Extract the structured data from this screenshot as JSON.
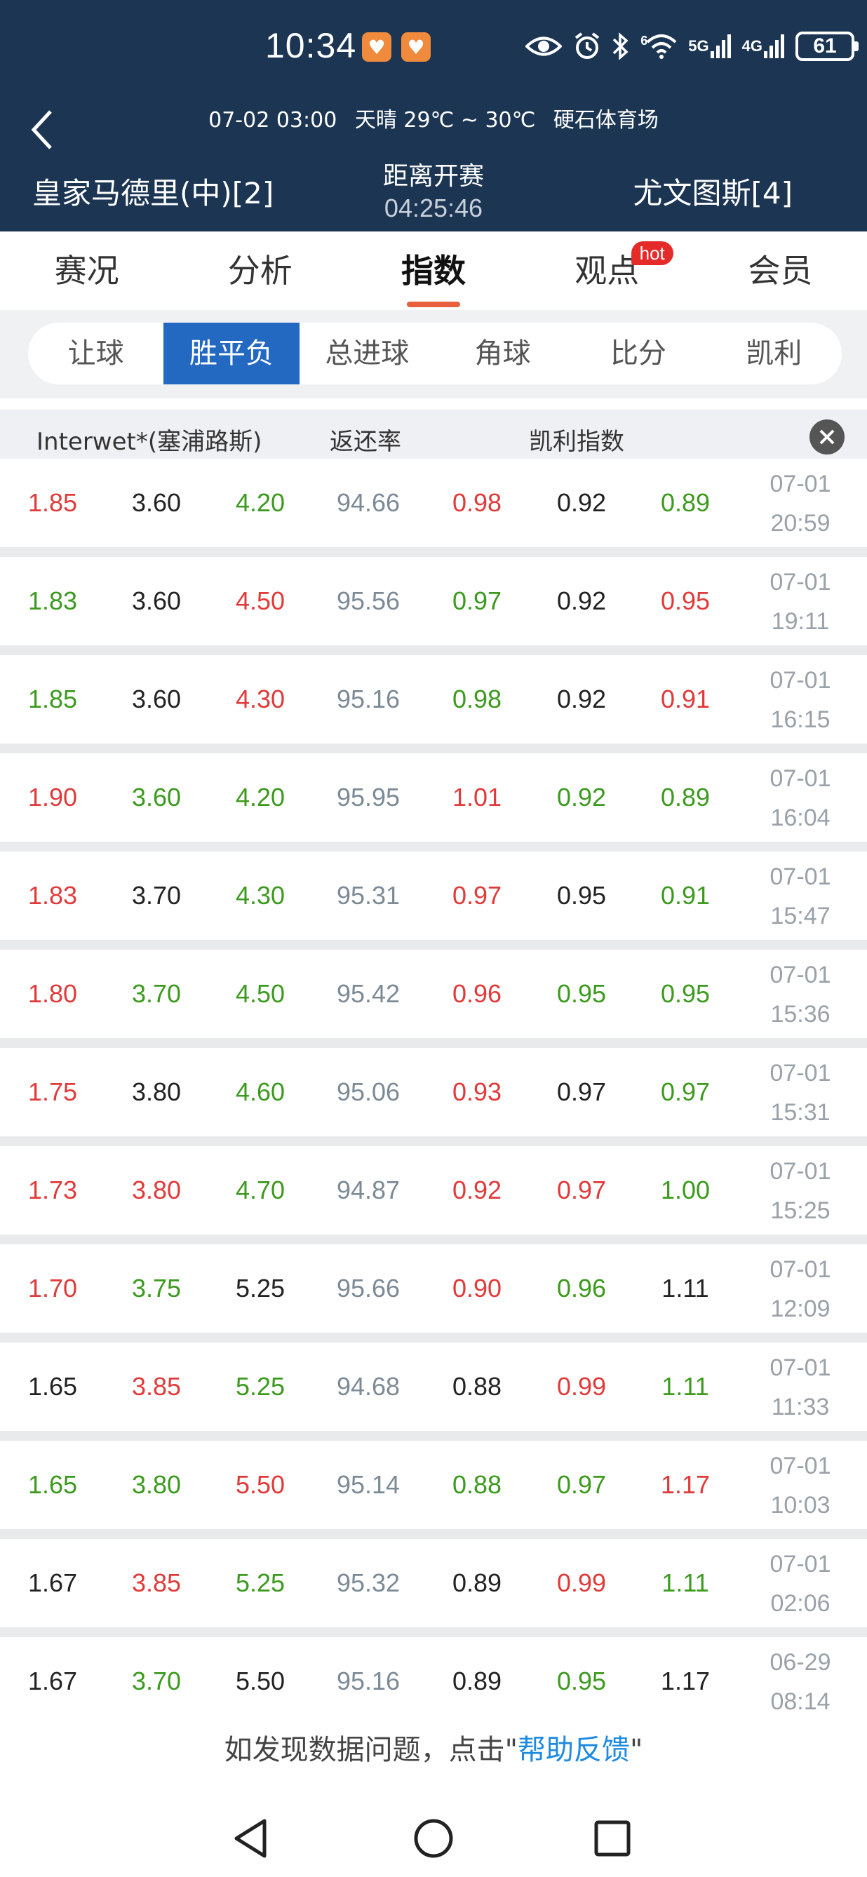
{
  "status_bar": {
    "time": "10:34",
    "battery": "61",
    "signal_1": "5G",
    "signal_2": "4G",
    "wifi_label": "6"
  },
  "match": {
    "info_date": "07-02 03:00",
    "info_weather": "天晴 29℃ ~ 30℃",
    "info_venue": "硬石体育场",
    "home_team": "皇家马德里(中)[2]",
    "away_team": "尤文图斯[4]",
    "countdown_label": "距离开赛",
    "countdown_value": "04:25:46"
  },
  "main_tabs": [
    {
      "label": "赛况"
    },
    {
      "label": "分析"
    },
    {
      "label": "指数"
    },
    {
      "label": "观点",
      "badge": "hot"
    },
    {
      "label": "会员"
    }
  ],
  "sub_tabs": [
    {
      "label": "让球"
    },
    {
      "label": "胜平负"
    },
    {
      "label": "总进球"
    },
    {
      "label": "角球"
    },
    {
      "label": "比分"
    },
    {
      "label": "凯利"
    }
  ],
  "table": {
    "col_company": "Interwet*(塞浦路斯)",
    "col_return": "返还率",
    "col_kelly": "凯利指数",
    "rows": [
      {
        "w": "1.85",
        "d": "3.60",
        "l": "4.20",
        "r": "94.66",
        "k1": "0.98",
        "k2": "0.92",
        "k3": "0.89",
        "date": "07-01",
        "time": "20:59",
        "cw": "red",
        "cd": "black",
        "cl": "green",
        "ck1": "red",
        "ck2": "black",
        "ck3": "green"
      },
      {
        "w": "1.83",
        "d": "3.60",
        "l": "4.50",
        "r": "95.56",
        "k1": "0.97",
        "k2": "0.92",
        "k3": "0.95",
        "date": "07-01",
        "time": "19:11",
        "cw": "green",
        "cd": "black",
        "cl": "red",
        "ck1": "green",
        "ck2": "black",
        "ck3": "red"
      },
      {
        "w": "1.85",
        "d": "3.60",
        "l": "4.30",
        "r": "95.16",
        "k1": "0.98",
        "k2": "0.92",
        "k3": "0.91",
        "date": "07-01",
        "time": "16:15",
        "cw": "green",
        "cd": "black",
        "cl": "red",
        "ck1": "green",
        "ck2": "black",
        "ck3": "red"
      },
      {
        "w": "1.90",
        "d": "3.60",
        "l": "4.20",
        "r": "95.95",
        "k1": "1.01",
        "k2": "0.92",
        "k3": "0.89",
        "date": "07-01",
        "time": "16:04",
        "cw": "red",
        "cd": "green",
        "cl": "green",
        "ck1": "red",
        "ck2": "green",
        "ck3": "green"
      },
      {
        "w": "1.83",
        "d": "3.70",
        "l": "4.30",
        "r": "95.31",
        "k1": "0.97",
        "k2": "0.95",
        "k3": "0.91",
        "date": "07-01",
        "time": "15:47",
        "cw": "red",
        "cd": "black",
        "cl": "green",
        "ck1": "red",
        "ck2": "black",
        "ck3": "green"
      },
      {
        "w": "1.80",
        "d": "3.70",
        "l": "4.50",
        "r": "95.42",
        "k1": "0.96",
        "k2": "0.95",
        "k3": "0.95",
        "date": "07-01",
        "time": "15:36",
        "cw": "red",
        "cd": "green",
        "cl": "green",
        "ck1": "red",
        "ck2": "green",
        "ck3": "green"
      },
      {
        "w": "1.75",
        "d": "3.80",
        "l": "4.60",
        "r": "95.06",
        "k1": "0.93",
        "k2": "0.97",
        "k3": "0.97",
        "date": "07-01",
        "time": "15:31",
        "cw": "red",
        "cd": "black",
        "cl": "green",
        "ck1": "red",
        "ck2": "black",
        "ck3": "green"
      },
      {
        "w": "1.73",
        "d": "3.80",
        "l": "4.70",
        "r": "94.87",
        "k1": "0.92",
        "k2": "0.97",
        "k3": "1.00",
        "date": "07-01",
        "time": "15:25",
        "cw": "red",
        "cd": "red",
        "cl": "green",
        "ck1": "red",
        "ck2": "red",
        "ck3": "green"
      },
      {
        "w": "1.70",
        "d": "3.75",
        "l": "5.25",
        "r": "95.66",
        "k1": "0.90",
        "k2": "0.96",
        "k3": "1.11",
        "date": "07-01",
        "time": "12:09",
        "cw": "red",
        "cd": "green",
        "cl": "black",
        "ck1": "red",
        "ck2": "green",
        "ck3": "black"
      },
      {
        "w": "1.65",
        "d": "3.85",
        "l": "5.25",
        "r": "94.68",
        "k1": "0.88",
        "k2": "0.99",
        "k3": "1.11",
        "date": "07-01",
        "time": "11:33",
        "cw": "black",
        "cd": "red",
        "cl": "green",
        "ck1": "black",
        "ck2": "red",
        "ck3": "green"
      },
      {
        "w": "1.65",
        "d": "3.80",
        "l": "5.50",
        "r": "95.14",
        "k1": "0.88",
        "k2": "0.97",
        "k3": "1.17",
        "date": "07-01",
        "time": "10:03",
        "cw": "green",
        "cd": "green",
        "cl": "red",
        "ck1": "green",
        "ck2": "green",
        "ck3": "red"
      },
      {
        "w": "1.67",
        "d": "3.85",
        "l": "5.25",
        "r": "95.32",
        "k1": "0.89",
        "k2": "0.99",
        "k3": "1.11",
        "date": "07-01",
        "time": "02:06",
        "cw": "black",
        "cd": "red",
        "cl": "green",
        "ck1": "black",
        "ck2": "red",
        "ck3": "green"
      },
      {
        "w": "1.67",
        "d": "3.70",
        "l": "5.50",
        "r": "95.16",
        "k1": "0.89",
        "k2": "0.95",
        "k3": "1.17",
        "date": "06-29",
        "time": "08:14",
        "cw": "black",
        "cd": "green",
        "cl": "black",
        "ck1": "black",
        "ck2": "green",
        "ck3": "black"
      }
    ]
  },
  "footer": {
    "feedback_prefix": "如发现数据问题，点击\"",
    "feedback_link": "帮助反馈",
    "feedback_suffix": "\""
  },
  "colors": {
    "header_bg": "#1b3553",
    "accent_blue": "#2369c1",
    "tab_underline": "#e8603c",
    "up_red": "#e03a3a",
    "down_green": "#3c9a1e",
    "link_blue": "#1e8ae0"
  }
}
